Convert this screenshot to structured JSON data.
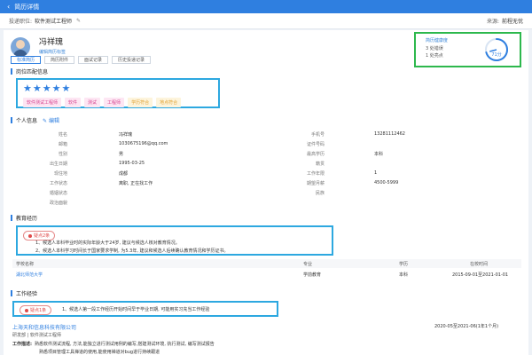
{
  "window": {
    "title": "简历详情"
  },
  "subbar": {
    "position_label": "投递职位:",
    "position_value": "软件测试工程师",
    "source_label": "来源:",
    "source_value": "前程无忧"
  },
  "profile": {
    "name": "冯祥瑰",
    "subtitle": "编辑简历标签"
  },
  "tabs": [
    "标准简历",
    "简历附件",
    "面试记录",
    "历史投递记录"
  ],
  "health": {
    "title": "简历健康度",
    "line1": "3 处错误",
    "line2": "1 处亮点",
    "score": "71分",
    "score_value": 71,
    "color": "#2f7fe0"
  },
  "sections": {
    "match": "岗位匹配信息",
    "personal": "个人信息",
    "edit": "编辑",
    "education": "教育经历",
    "work": "工作经验"
  },
  "match": {
    "stars": 5,
    "tags": [
      {
        "text": "软件测试工程师",
        "style": "pink"
      },
      {
        "text": "软件",
        "style": "pink"
      },
      {
        "text": "测试",
        "style": "pink"
      },
      {
        "text": "工程师",
        "style": "pink"
      },
      {
        "text": "学历符合",
        "style": "yellow"
      },
      {
        "text": "地点符合",
        "style": "yellow"
      }
    ]
  },
  "personal": {
    "left": [
      {
        "label": "姓名",
        "value": "冯祥瑰"
      },
      {
        "label": "邮箱",
        "value": "1030675196@qq.com"
      },
      {
        "label": "性别",
        "value": "男"
      },
      {
        "label": "出生日期",
        "value": "1995-03-25"
      },
      {
        "label": "现住地",
        "value": "成都"
      },
      {
        "label": "工作状态",
        "value": "离职, 正在找工作"
      },
      {
        "label": "婚姻状态",
        "value": ""
      },
      {
        "label": "政治面貌",
        "value": ""
      }
    ],
    "right": [
      {
        "label": "手机号",
        "value": "13281112462"
      },
      {
        "label": "证件号码",
        "value": ""
      },
      {
        "label": "最高学历",
        "value": "本科"
      },
      {
        "label": "籍贯",
        "value": ""
      },
      {
        "label": "工作年限",
        "value": "1"
      },
      {
        "label": "期望月薪",
        "value": "4500-5999"
      },
      {
        "label": "民族",
        "value": ""
      }
    ]
  },
  "education": {
    "alert": "疑点2条",
    "lines": [
      "1、候选人本科毕业时的实际年龄大于24岁, 建议与候选人核对教育情况。",
      "2、候选人本科学习时间长于国家要求学制, 为5.3年, 建议和候选人后续确认教育情况和学历证书。"
    ],
    "headers": [
      "学校名称",
      "专业",
      "学历",
      "在校时间"
    ],
    "rows": [
      {
        "school": "湖北师范大学",
        "major": "学前教育",
        "degree": "本科",
        "time": "2015-09-01至2021-01-01"
      }
    ]
  },
  "work": {
    "alert": "疑点1条",
    "line": "1、候选人第一段工作经历开始时间早于毕业日期, 可能用实习充当工作经验",
    "company": "上海天和信息科技有限公司",
    "period": "2020-05至2021-06(1年1个月)",
    "role": "研发部 | 软件测试工程师",
    "duties_label": "工作描述:",
    "duties": "熟悉软件测试流程, 方法,能独立进行测试用例的编写,搭建测试环境, 执行测试, 编写测试报告",
    "duties2": "熟悉项目管理工具禅道的使用,能使用禅道对bug进行持续跟进"
  }
}
